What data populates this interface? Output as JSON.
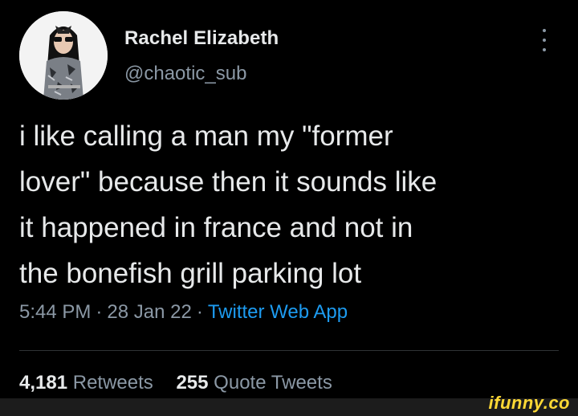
{
  "tweet": {
    "author": {
      "display_name": "Rachel Elizabeth",
      "handle": "@chaotic_sub"
    },
    "text_lines": [
      "i like calling a man my \"former",
      "lover\" because then it sounds like",
      "it happened in france and not in",
      "the bonefish grill parking lot"
    ],
    "meta": {
      "time": "5:44 PM",
      "separator": "·",
      "date": "28 Jan 22",
      "source": "Twitter Web App"
    },
    "stats": {
      "retweets_count": "4,181",
      "retweets_label": "Retweets",
      "quotes_count": "255",
      "quotes_label": "Quote Tweets"
    }
  },
  "watermark": "ifunny.co",
  "icons": {
    "more": "more-vertical-icon",
    "avatar": "profile-photo"
  },
  "colors": {
    "background": "#000000",
    "primary_text": "#e7e9ea",
    "secondary_text": "#8b98a5",
    "link": "#1d9bf0",
    "divider": "#2f3336",
    "watermark": "#fdd835"
  }
}
